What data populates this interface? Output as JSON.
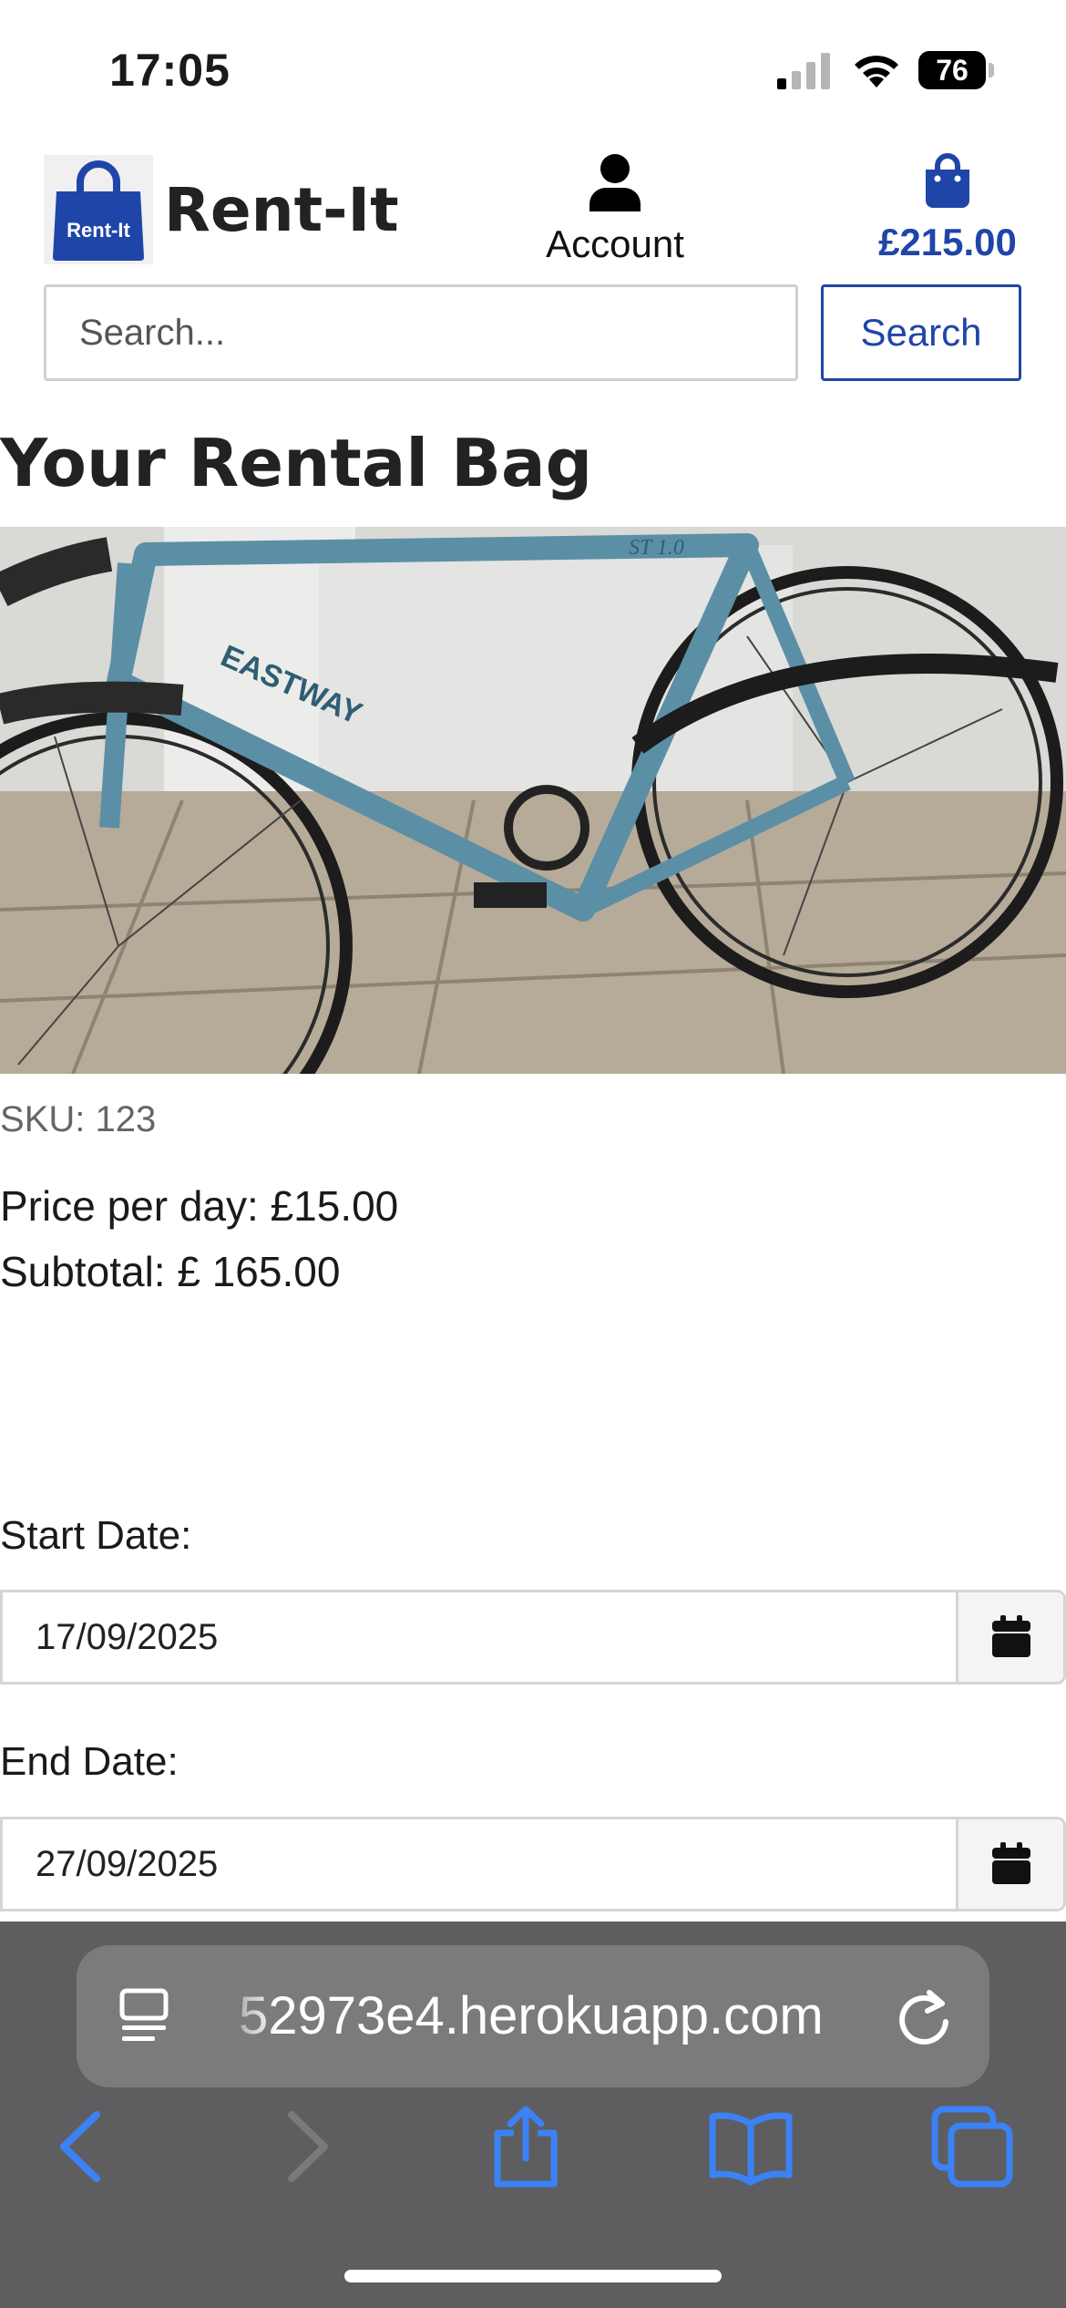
{
  "status_bar": {
    "time": "17:05",
    "battery": "76"
  },
  "header": {
    "logo_text": "Rent-It",
    "brand_name": "Rent-It",
    "account_label": "Account",
    "bag_total": "£215.00",
    "accent_color": "#1f45a9"
  },
  "search": {
    "placeholder": "Search...",
    "button_label": "Search"
  },
  "page": {
    "title": "Your Rental Bag"
  },
  "item": {
    "image_frame_text": "EASTWAY",
    "image_tube_text": "ST 1.0",
    "sku": "SKU: 123",
    "price": "Price per day: £15.00",
    "subtotal": "Subtotal: £ 165.00"
  },
  "dates": {
    "start_label": "Start Date:",
    "start_value": "17/09/2025",
    "end_label": "End Date:",
    "end_value": "27/09/2025"
  },
  "browser": {
    "url": "52973e4.herokuapp.com"
  },
  "icons": [
    "reader-icon",
    "reload-icon",
    "back-icon",
    "forward-icon",
    "share-icon",
    "bookmarks-icon",
    "tabs-icon",
    "calendar-icon",
    "user-icon",
    "shopping-bag-icon"
  ]
}
